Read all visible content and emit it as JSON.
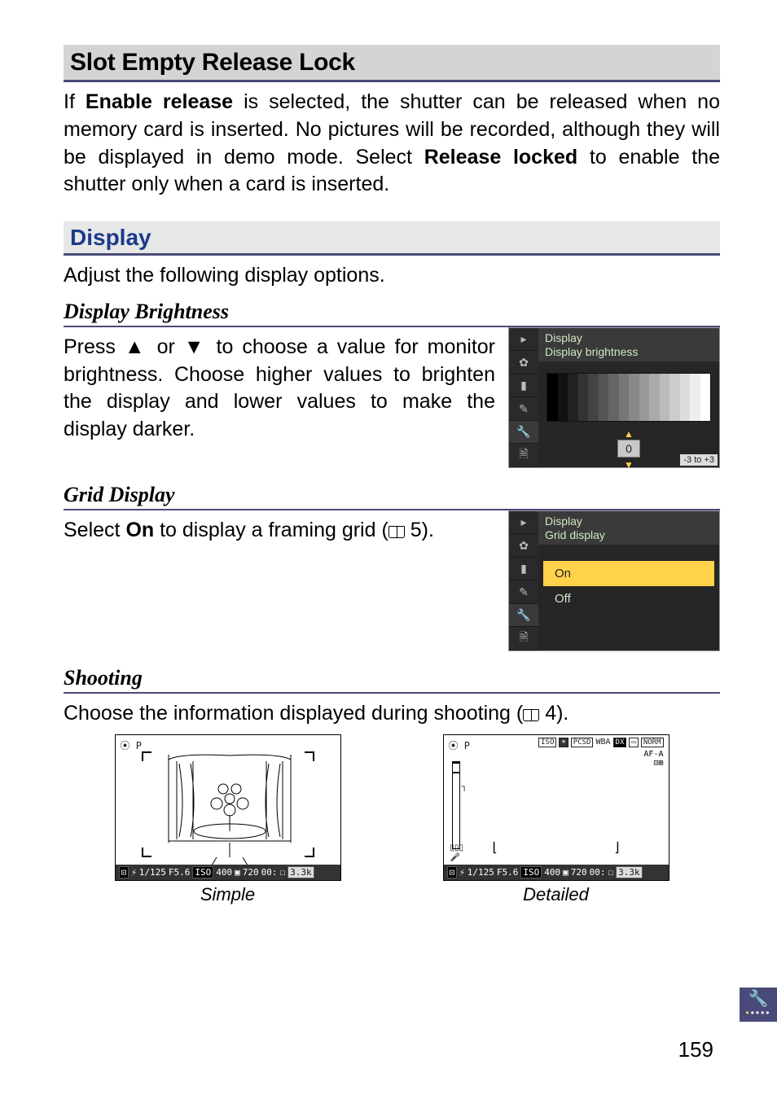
{
  "sections": {
    "slot_empty": {
      "title": "Slot Empty Release Lock",
      "body_prefix": "If ",
      "bold_enable": "Enable release",
      "body_mid": " is selected, the shutter can be released when no memory card is inserted. No pictures will be recorded, although they will be displayed in demo mode. Select ",
      "bold_locked": "Release locked",
      "body_suffix": " to enable the shutter only when a card is inserted."
    },
    "display": {
      "title": "Display",
      "intro": "Adjust the following display options."
    },
    "brightness": {
      "title": "Display Brightness",
      "text_prefix": "Press ",
      "arrow_up": "▲",
      "text_or": " or ",
      "arrow_dn": "▼",
      "text_rest": " to choose a value for monitor brightness. Choose higher values to brighten the display and lower values to make the display darker.",
      "lcd_title1": "Display",
      "lcd_title2": "Display brightness",
      "lcd_zero": "0",
      "lcd_range": "-3 to +3"
    },
    "grid": {
      "title": "Grid Display",
      "text_prefix": "Select ",
      "bold_on": "On",
      "text_mid": " to display a framing grid (",
      "page_ref": "5",
      "text_suffix": ").",
      "lcd_title1": "Display",
      "lcd_title2": "Grid display",
      "opt_on": "On",
      "opt_off": "Off"
    },
    "shooting": {
      "title": "Shooting",
      "text_prefix": "Choose the information displayed during shooting (",
      "page_ref": "4",
      "text_suffix": ").",
      "simple_caption": "Simple",
      "detailed_caption": "Detailed",
      "vf_topleft_rec": "⦿",
      "vf_topleft_mode": "P",
      "topbadges": {
        "iso": "ISO",
        "exp": "☀",
        "picsd": "PCSD",
        "wb": "WBA",
        "dx": "DX",
        "size": "▭",
        "norm": "NORM"
      },
      "af_line1": "AF-A",
      "af_line2": "⊡⊞",
      "statusbar": {
        "af": "⊡",
        "bolt": "⚡",
        "sspeed": "1/125",
        "fnum": "F5.6",
        "isoicon": "ISO",
        "iso": "400",
        "ev": "▣",
        "count": "720",
        "time": "00:",
        "sd": "☐",
        "batt": "3.3k"
      }
    }
  },
  "page_number": "159"
}
